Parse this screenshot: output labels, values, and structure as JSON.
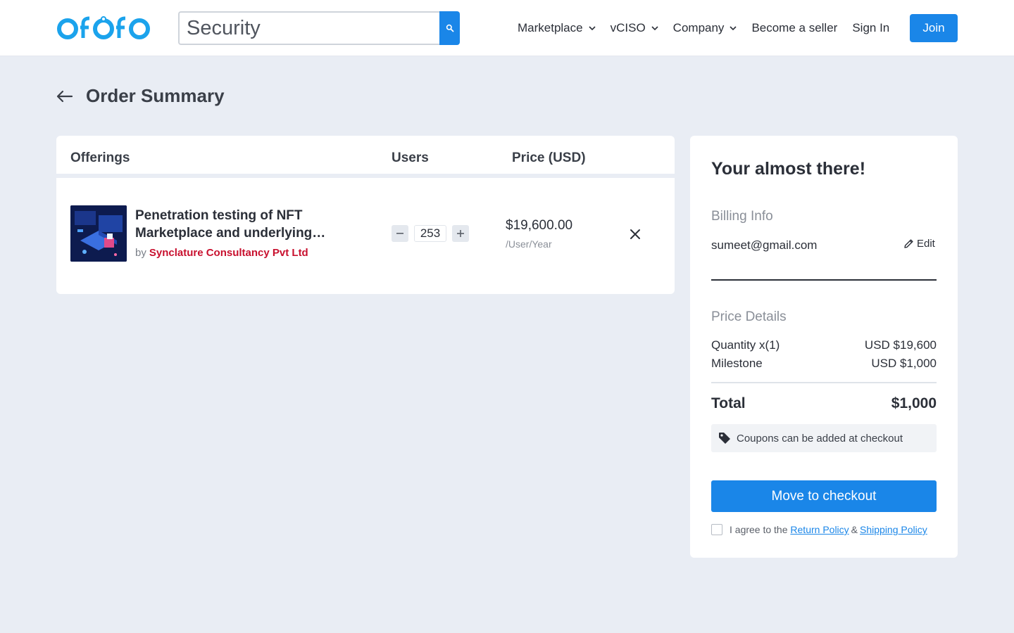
{
  "header": {
    "logo_text": "OfOfO",
    "search": {
      "value": "Security"
    },
    "nav": [
      {
        "label": "Marketplace",
        "has_dropdown": true
      },
      {
        "label": "vCISO",
        "has_dropdown": true
      },
      {
        "label": "Company",
        "has_dropdown": true
      },
      {
        "label": "Become a seller",
        "has_dropdown": false
      },
      {
        "label": "Sign In",
        "has_dropdown": false
      }
    ],
    "join_label": "Join"
  },
  "page": {
    "title": "Order Summary"
  },
  "offerings": {
    "columns": {
      "offerings": "Offerings",
      "users": "Users",
      "price": "Price (USD)"
    },
    "items": [
      {
        "title": "Penetration testing of NFT Marketplace and underlying…",
        "by_label": "by",
        "vendor": "Synclature Consultancy Pvt Ltd",
        "users": "253",
        "price": "$19,600.00",
        "per": "/User/Year"
      }
    ]
  },
  "summary": {
    "heading": "Your almost there!",
    "billing_label": "Billing Info",
    "email": "sumeet@gmail.com",
    "edit_label": "Edit",
    "price_details_label": "Price Details",
    "lines": [
      {
        "label": "Quantity x(1)",
        "value": "USD $19,600"
      },
      {
        "label": "Milestone",
        "value": "USD $1,000"
      }
    ],
    "total_label": "Total",
    "total_value": "$1,000",
    "coupon_text": "Coupons can be added at checkout",
    "checkout_label": "Move to checkout",
    "agree_text": "I agree to the",
    "return_policy": "Return Policy",
    "amp": "&",
    "shipping_policy": "Shipping Policy"
  },
  "colors": {
    "accent": "#1a86e8",
    "logo": "#1ba3ec",
    "vendor": "#c8102e",
    "page_bg": "#e9edf4"
  }
}
